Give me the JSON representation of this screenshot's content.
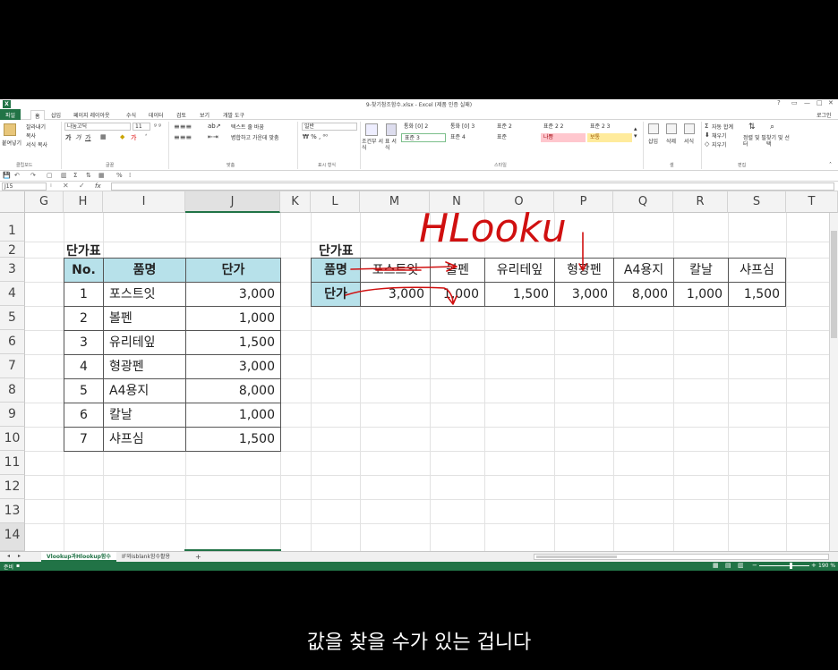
{
  "window": {
    "title": "9-찾기참조함수.xlsx - Excel (제품 인증 실패)",
    "controls": [
      "?",
      "▭",
      "—",
      "□",
      "✕"
    ],
    "login": "로그인",
    "app_icon": "X"
  },
  "tabs": [
    "파일",
    "홈",
    "삽입",
    "페이지 레이아웃",
    "수식",
    "데이터",
    "검토",
    "보기",
    "개발 도구"
  ],
  "ribbon": {
    "clipboard": {
      "paste": "붙여넣기",
      "cut": "잘라내기",
      "copy": "복사",
      "format_painter": "서식 복사",
      "group": "클립보드"
    },
    "font": {
      "name": "나눔고딕",
      "size": "11",
      "group": "글꼴"
    },
    "align": {
      "wrap": "텍스트 줄 바꿈",
      "merge": "병합하고 가운데 맞춤",
      "group": "맞춤"
    },
    "number": {
      "format": "일반",
      "group": "표시 형식"
    },
    "styles": {
      "conditional": "조건부 서식",
      "table": "표 서식",
      "items": [
        "통화 [0] 2",
        "통화 [0] 3",
        "표준 2",
        "표준 2 2",
        "표준 2 3",
        "표준 3",
        "표준 4",
        "표준",
        "나쁨",
        "보통"
      ],
      "group": "스타일"
    },
    "cells": {
      "insert": "삽입",
      "delete": "삭제",
      "format": "서식",
      "group": "셀"
    },
    "editing": {
      "autosum": "자동 합계",
      "fill": "채우기",
      "clear": "지우기",
      "sort": "정렬 및 필터",
      "find": "찾기 및 선택",
      "group": "편집"
    }
  },
  "namebox": "J15",
  "fx": "fx",
  "columns": [
    "G",
    "H",
    "I",
    "J",
    "K",
    "L",
    "M",
    "N",
    "O",
    "P",
    "Q",
    "R",
    "S",
    "T"
  ],
  "rows": [
    "1",
    "2",
    "3",
    "4",
    "5",
    "6",
    "7",
    "8",
    "9",
    "10",
    "11",
    "12",
    "13",
    "14"
  ],
  "vtable": {
    "caption": "단가표",
    "headers": [
      "No.",
      "품명",
      "단가"
    ],
    "rows": [
      [
        "1",
        "포스트잇",
        "3,000"
      ],
      [
        "2",
        "볼펜",
        "1,000"
      ],
      [
        "3",
        "유리테잎",
        "1,500"
      ],
      [
        "4",
        "형광펜",
        "3,000"
      ],
      [
        "5",
        "A4용지",
        "8,000"
      ],
      [
        "6",
        "칼날",
        "1,000"
      ],
      [
        "7",
        "샤프심",
        "1,500"
      ]
    ]
  },
  "htable": {
    "caption": "단가표",
    "row1_header": "품명",
    "row2_header": "단가",
    "items": [
      "포스트잇",
      "볼펜",
      "유리테잎",
      "형광펜",
      "A4용지",
      "칼날",
      "샤프심"
    ],
    "prices": [
      "3,000",
      "1,000",
      "1,500",
      "3,000",
      "8,000",
      "1,000",
      "1,500"
    ]
  },
  "annotation": {
    "text": "HLooku",
    "color": "#d01010"
  },
  "sheets": {
    "active": "Vlookup과Hlookup함수",
    "other": "IF와isblank함수활용",
    "add": "+"
  },
  "status": {
    "ready": "준비",
    "zoom": "190 %"
  },
  "subtitle": "값을 찾을 수가 있는 겁니다",
  "colors": {
    "excel_green": "#217346",
    "header_fill": "#b7e1ea",
    "bad": "#ffc7ce",
    "neutral": "#ffeb9c"
  }
}
